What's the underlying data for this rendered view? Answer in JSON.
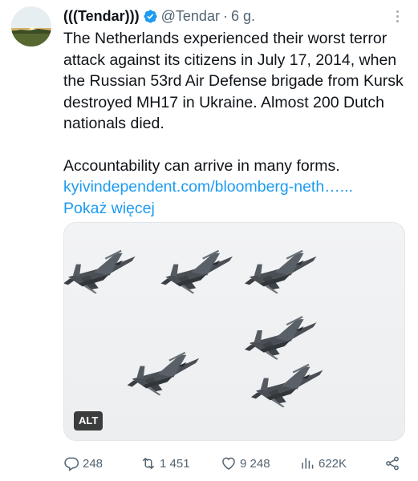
{
  "author": {
    "display_name": "(((Tendar)))",
    "handle": "@Tendar",
    "separator": "·",
    "time": "6 g.",
    "verified_color": "#1d9bf0"
  },
  "tweet": {
    "text_p1": "The Netherlands experienced their worst terror attack against its citizens in July 17, 2014, when the Russian 53rd Air Defense brigade from Kursk destroyed MH17 in Ukraine. Almost 200 Dutch nationals died.",
    "text_p2": "Accountability can arrive in many forms.",
    "link": "kyivindependent.com/bloomberg-neth…...",
    "show_more": "Pokaż więcej"
  },
  "media": {
    "alt_label": "ALT",
    "subject": "six fighter jets in formation"
  },
  "actions": {
    "reply_count": "248",
    "repost_count": "1 451",
    "like_count": "9 248",
    "views_count": "622K"
  },
  "colors": {
    "accent": "#1d9bf0",
    "secondary_text": "#536471"
  }
}
